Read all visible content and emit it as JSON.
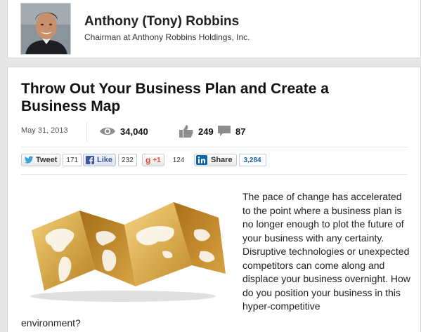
{
  "author": {
    "name": "Anthony (Tony) Robbins",
    "title": "Chairman at Anthony Robbins Holdings, Inc."
  },
  "article": {
    "title": "Throw Out Your Business Plan and Create a Business Map",
    "date": "May 31, 2013",
    "stats": {
      "views": "34,040",
      "likes": "249",
      "comments": "87"
    },
    "social": {
      "tweet_label": "Tweet",
      "tweet_count": "171",
      "like_label": "Like",
      "like_count": "232",
      "gplus_label": "+1",
      "gplus_count": "124",
      "share_label": "Share",
      "share_count": "3,284"
    },
    "body_main": "The pace of change has accelerated to the point where a business plan is no longer enough to plot the future of your business with any certainty. Disruptive technologies or unexpected competitors can come along and displace your business overnight. How do you position your business in this hyper-competitive",
    "body_tail": "environment?"
  },
  "icons": {
    "views": "eye-icon",
    "likes": "thumbs-up-icon",
    "comments": "speech-bubble-icon",
    "twitter": "twitter-bird-icon",
    "facebook": "facebook-f-icon",
    "linkedin": "linkedin-in-icon"
  },
  "colors": {
    "twitter": "#3aa1dc",
    "facebook": "#3b5998",
    "gplus": "#dd4b39",
    "linkedin": "#0a66a8",
    "map_gold": "#c9952c"
  }
}
